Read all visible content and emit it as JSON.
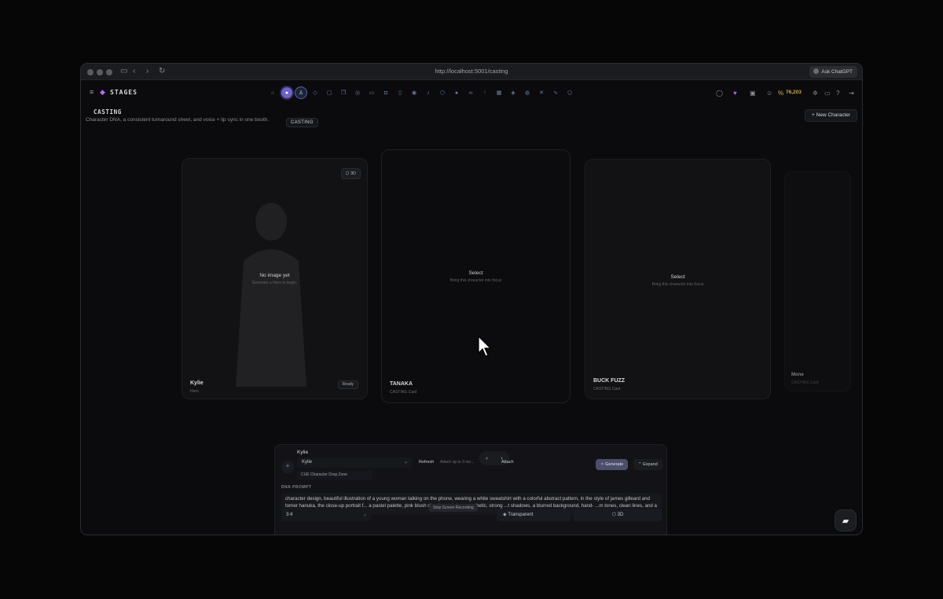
{
  "browser": {
    "url": "http://localhost:5001/casting",
    "ask_button": "Ask ChatGPT"
  },
  "app": {
    "brand": "STAGES",
    "tooltip": "CASTING",
    "credits": "76,203",
    "nav_icons": [
      "home-icon",
      "planet-icon",
      "casting-icon",
      "cube-icon",
      "chat-icon",
      "gallery-icon",
      "spark-icon",
      "video-icon",
      "camera-icon",
      "phone-icon",
      "eye-icon",
      "music-icon",
      "box-icon",
      "orb-icon",
      "link-icon",
      "bulb-icon",
      "gift-icon",
      "shield-icon",
      "globe-icon",
      "grid-icon",
      "wave-icon",
      "badge-icon"
    ]
  },
  "page": {
    "title": "CASTING",
    "subtitle": "Character DNA, a consistent turnaround sheet, and voice + lip sync in one booth.",
    "new_character": "New Character"
  },
  "cards": [
    {
      "name": "Kylie",
      "role": "Hero",
      "empty_title": "No image yet",
      "empty_sub": "Generate a Hero to begin.",
      "badge": "3D",
      "status": "Ready"
    },
    {
      "name": "TANAKA",
      "role": "CASTING Card",
      "empty_title": "Select",
      "empty_sub": "Bring this character into focus"
    },
    {
      "name": "BUCK FUZZ",
      "role": "CASTING Card",
      "empty_title": "Select",
      "empty_sub": "Bring this character into focus"
    },
    {
      "name": "Mone",
      "role": "CASTING Card"
    }
  ],
  "panel": {
    "character_label": "Kylie",
    "select_value": "Kylie",
    "refresh": "Refresh",
    "attach_hint": "Attach up to 3 mo...",
    "attach": "Attach",
    "drop_zone": "CUE Character Drop Zone",
    "generate": "Generate",
    "expand": "Expand",
    "dna_label": "DNA PROMPT",
    "prompt": "character design, beautiful illustration of a young woman talking on the phone, wearing a white sweatshirt with a colorful abstract pattern, in the style of james gilleard and tomer hanuka, the close-up portrait f... a pastel palette, pink blush cheeks, a vintage aesthetic, strong ...t shadows, a blurred background, hand- ...m tones, clean lines, and a minimalistic c...",
    "ratio": "3:4",
    "stop_recording": "Stop Screen Recording",
    "transparent": "Transparent",
    "threed": "3D"
  }
}
